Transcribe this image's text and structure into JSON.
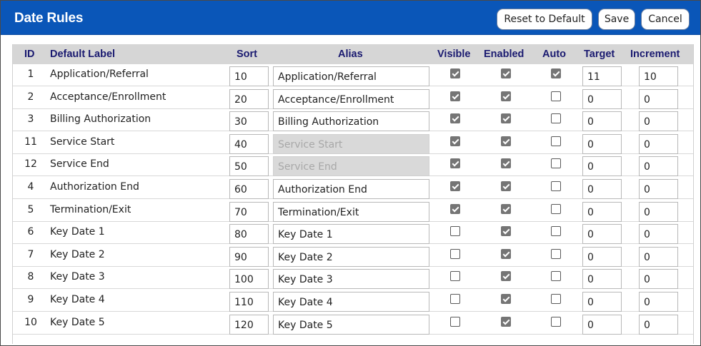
{
  "dialog": {
    "title": "Date Rules",
    "buttons": {
      "reset": "Reset to Default",
      "save": "Save",
      "cancel": "Cancel"
    }
  },
  "table": {
    "columns": {
      "id": "ID",
      "label": "Default Label",
      "sort": "Sort",
      "alias": "Alias",
      "visible": "Visible",
      "enabled": "Enabled",
      "auto": "Auto",
      "target": "Target",
      "increment": "Increment"
    },
    "rows": [
      {
        "id": "1",
        "label": "Application/Referral",
        "sort": "10",
        "alias": "Application/Referral",
        "alias_disabled": false,
        "visible": true,
        "enabled": true,
        "auto": true,
        "target": "11",
        "increment": "10"
      },
      {
        "id": "2",
        "label": "Acceptance/Enrollment",
        "sort": "20",
        "alias": "Acceptance/Enrollment",
        "alias_disabled": false,
        "visible": true,
        "enabled": true,
        "auto": false,
        "target": "0",
        "increment": "0"
      },
      {
        "id": "3",
        "label": "Billing Authorization",
        "sort": "30",
        "alias": "Billing Authorization",
        "alias_disabled": false,
        "visible": true,
        "enabled": true,
        "auto": false,
        "target": "0",
        "increment": "0"
      },
      {
        "id": "11",
        "label": "Service Start",
        "sort": "40",
        "alias": "Service Start",
        "alias_disabled": true,
        "visible": true,
        "enabled": true,
        "auto": false,
        "target": "0",
        "increment": "0"
      },
      {
        "id": "12",
        "label": "Service End",
        "sort": "50",
        "alias": "Service End",
        "alias_disabled": true,
        "visible": true,
        "enabled": true,
        "auto": false,
        "target": "0",
        "increment": "0"
      },
      {
        "id": "4",
        "label": "Authorization End",
        "sort": "60",
        "alias": "Authorization End",
        "alias_disabled": false,
        "visible": true,
        "enabled": true,
        "auto": false,
        "target": "0",
        "increment": "0"
      },
      {
        "id": "5",
        "label": "Termination/Exit",
        "sort": "70",
        "alias": "Termination/Exit",
        "alias_disabled": false,
        "visible": true,
        "enabled": true,
        "auto": false,
        "target": "0",
        "increment": "0"
      },
      {
        "id": "6",
        "label": "Key Date 1",
        "sort": "80",
        "alias": "Key Date 1",
        "alias_disabled": false,
        "visible": false,
        "enabled": true,
        "auto": false,
        "target": "0",
        "increment": "0"
      },
      {
        "id": "7",
        "label": "Key Date 2",
        "sort": "90",
        "alias": "Key Date 2",
        "alias_disabled": false,
        "visible": false,
        "enabled": true,
        "auto": false,
        "target": "0",
        "increment": "0"
      },
      {
        "id": "8",
        "label": "Key Date 3",
        "sort": "100",
        "alias": "Key Date 3",
        "alias_disabled": false,
        "visible": false,
        "enabled": true,
        "auto": false,
        "target": "0",
        "increment": "0"
      },
      {
        "id": "9",
        "label": "Key Date 4",
        "sort": "110",
        "alias": "Key Date 4",
        "alias_disabled": false,
        "visible": false,
        "enabled": true,
        "auto": false,
        "target": "0",
        "increment": "0"
      },
      {
        "id": "10",
        "label": "Key Date 5",
        "sort": "120",
        "alias": "Key Date 5",
        "alias_disabled": false,
        "visible": false,
        "enabled": true,
        "auto": false,
        "target": "0",
        "increment": "0"
      }
    ]
  },
  "colors": {
    "titlebar": "#0a56b8",
    "header_bg": "#d6d6d6",
    "header_text": "#1a1a70",
    "checkbox_checked": "#757575"
  }
}
